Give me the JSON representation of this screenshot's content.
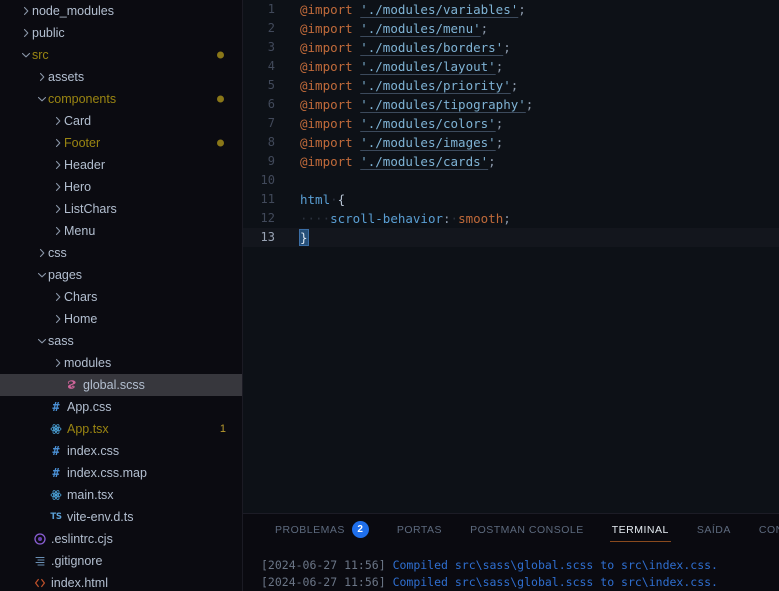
{
  "explorer": {
    "items": [
      {
        "label": "node_modules",
        "type": "folder",
        "state": "collapsed",
        "depth": 1,
        "color": "default",
        "icon": "chevron-right-icon"
      },
      {
        "label": "public",
        "type": "folder",
        "state": "collapsed",
        "depth": 1,
        "color": "default",
        "icon": "chevron-right-icon"
      },
      {
        "label": "src",
        "type": "folder",
        "state": "expanded",
        "depth": 1,
        "color": "modified",
        "icon": "chevron-down-icon",
        "dirty": true
      },
      {
        "label": "assets",
        "type": "folder",
        "state": "collapsed",
        "depth": 2,
        "color": "default",
        "icon": "chevron-right-icon"
      },
      {
        "label": "components",
        "type": "folder",
        "state": "expanded",
        "depth": 2,
        "color": "modified",
        "icon": "chevron-down-icon",
        "dirty": true
      },
      {
        "label": "Card",
        "type": "folder",
        "state": "collapsed",
        "depth": 3,
        "color": "default",
        "icon": "chevron-right-icon"
      },
      {
        "label": "Footer",
        "type": "folder",
        "state": "collapsed",
        "depth": 3,
        "color": "modified",
        "icon": "chevron-right-icon",
        "dirty": true
      },
      {
        "label": "Header",
        "type": "folder",
        "state": "collapsed",
        "depth": 3,
        "color": "default",
        "icon": "chevron-right-icon"
      },
      {
        "label": "Hero",
        "type": "folder",
        "state": "collapsed",
        "depth": 3,
        "color": "default",
        "icon": "chevron-right-icon"
      },
      {
        "label": "ListChars",
        "type": "folder",
        "state": "collapsed",
        "depth": 3,
        "color": "default",
        "icon": "chevron-right-icon"
      },
      {
        "label": "Menu",
        "type": "folder",
        "state": "collapsed",
        "depth": 3,
        "color": "default",
        "icon": "chevron-right-icon"
      },
      {
        "label": "css",
        "type": "folder",
        "state": "collapsed",
        "depth": 2,
        "color": "default",
        "icon": "chevron-right-icon"
      },
      {
        "label": "pages",
        "type": "folder",
        "state": "expanded",
        "depth": 2,
        "color": "default",
        "icon": "chevron-down-icon"
      },
      {
        "label": "Chars",
        "type": "folder",
        "state": "collapsed",
        "depth": 3,
        "color": "default",
        "icon": "chevron-right-icon"
      },
      {
        "label": "Home",
        "type": "folder",
        "state": "collapsed",
        "depth": 3,
        "color": "default",
        "icon": "chevron-right-icon"
      },
      {
        "label": "sass",
        "type": "folder",
        "state": "expanded",
        "depth": 2,
        "color": "default",
        "icon": "chevron-down-icon"
      },
      {
        "label": "modules",
        "type": "folder",
        "state": "collapsed",
        "depth": 3,
        "color": "default",
        "icon": "chevron-right-icon"
      },
      {
        "label": "global.scss",
        "type": "file",
        "depth": 3,
        "color": "default",
        "icon": "sass-icon",
        "selected": true
      },
      {
        "label": "App.css",
        "type": "file",
        "depth": 2,
        "color": "default",
        "icon": "css-icon"
      },
      {
        "label": "App.tsx",
        "type": "file",
        "depth": 2,
        "color": "modified",
        "icon": "react-icon",
        "badge": "1"
      },
      {
        "label": "index.css",
        "type": "file",
        "depth": 2,
        "color": "default",
        "icon": "css-icon"
      },
      {
        "label": "index.css.map",
        "type": "file",
        "depth": 2,
        "color": "default",
        "icon": "css-icon"
      },
      {
        "label": "main.tsx",
        "type": "file",
        "depth": 2,
        "color": "default",
        "icon": "react-icon"
      },
      {
        "label": "vite-env.d.ts",
        "type": "file",
        "depth": 2,
        "color": "default",
        "icon": "typescript-icon"
      },
      {
        "label": ".eslintrc.cjs",
        "type": "file",
        "depth": 1,
        "color": "default",
        "icon": "eslint-icon"
      },
      {
        "label": ".gitignore",
        "type": "file",
        "depth": 1,
        "color": "default",
        "icon": "gitignore-icon"
      },
      {
        "label": "index.html",
        "type": "file",
        "depth": 1,
        "color": "default",
        "icon": "html-icon"
      }
    ]
  },
  "editor": {
    "lines": [
      {
        "num": "1",
        "tokens": [
          {
            "t": "at",
            "v": "@import"
          },
          {
            "t": "sp",
            "v": " "
          },
          {
            "t": "str",
            "v": "'./modules/variables'"
          },
          {
            "t": "punct",
            "v": ";"
          }
        ]
      },
      {
        "num": "2",
        "tokens": [
          {
            "t": "at",
            "v": "@import"
          },
          {
            "t": "sp",
            "v": " "
          },
          {
            "t": "str",
            "v": "'./modules/menu'"
          },
          {
            "t": "punct",
            "v": ";"
          }
        ]
      },
      {
        "num": "3",
        "tokens": [
          {
            "t": "at",
            "v": "@import"
          },
          {
            "t": "sp",
            "v": " "
          },
          {
            "t": "str",
            "v": "'./modules/borders'"
          },
          {
            "t": "punct",
            "v": ";"
          }
        ]
      },
      {
        "num": "4",
        "tokens": [
          {
            "t": "at",
            "v": "@import"
          },
          {
            "t": "sp",
            "v": " "
          },
          {
            "t": "str",
            "v": "'./modules/layout'"
          },
          {
            "t": "punct",
            "v": ";"
          }
        ]
      },
      {
        "num": "5",
        "tokens": [
          {
            "t": "at",
            "v": "@import"
          },
          {
            "t": "sp",
            "v": " "
          },
          {
            "t": "str",
            "v": "'./modules/priority'"
          },
          {
            "t": "punct",
            "v": ";"
          }
        ]
      },
      {
        "num": "6",
        "tokens": [
          {
            "t": "at",
            "v": "@import"
          },
          {
            "t": "sp",
            "v": " "
          },
          {
            "t": "str",
            "v": "'./modules/tipography'"
          },
          {
            "t": "punct",
            "v": ";"
          }
        ]
      },
      {
        "num": "7",
        "tokens": [
          {
            "t": "at",
            "v": "@import"
          },
          {
            "t": "sp",
            "v": " "
          },
          {
            "t": "str",
            "v": "'./modules/colors'"
          },
          {
            "t": "punct",
            "v": ";"
          }
        ]
      },
      {
        "num": "8",
        "tokens": [
          {
            "t": "at",
            "v": "@import"
          },
          {
            "t": "sp",
            "v": " "
          },
          {
            "t": "str",
            "v": "'./modules/images'"
          },
          {
            "t": "punct",
            "v": ";"
          }
        ]
      },
      {
        "num": "9",
        "tokens": [
          {
            "t": "at",
            "v": "@import"
          },
          {
            "t": "sp",
            "v": " "
          },
          {
            "t": "str",
            "v": "'./modules/cards'"
          },
          {
            "t": "punct",
            "v": ";"
          }
        ]
      },
      {
        "num": "10",
        "tokens": []
      },
      {
        "num": "11",
        "tokens": [
          {
            "t": "tag",
            "v": "html"
          },
          {
            "t": "ws",
            "v": "·"
          },
          {
            "t": "brace",
            "v": "{"
          }
        ]
      },
      {
        "num": "12",
        "tokens": [
          {
            "t": "ws",
            "v": "····"
          },
          {
            "t": "prop",
            "v": "scroll-behavior"
          },
          {
            "t": "punct",
            "v": ":"
          },
          {
            "t": "ws",
            "v": "·"
          },
          {
            "t": "val",
            "v": "smooth"
          },
          {
            "t": "punct",
            "v": ";"
          }
        ]
      },
      {
        "num": "13",
        "tokens": [
          {
            "t": "selbrace",
            "v": "}"
          }
        ],
        "active": true
      }
    ]
  },
  "panel": {
    "tabs": [
      {
        "label": "PROBLEMAS",
        "active": false,
        "badge": "2"
      },
      {
        "label": "PORTAS",
        "active": false
      },
      {
        "label": "POSTMAN CONSOLE",
        "active": false
      },
      {
        "label": "TERMINAL",
        "active": true
      },
      {
        "label": "SAÍDA",
        "active": false
      },
      {
        "label": "CONSOLE DE DEP",
        "active": false
      }
    ],
    "terminal": {
      "lines": [
        {
          "timestamp": "[2024-06-27 11:56]",
          "message": "Compiled src\\sass\\global.scss to src\\index.css."
        },
        {
          "timestamp": "[2024-06-27 11:56]",
          "message": "Compiled src\\sass\\global.scss to src\\index.css."
        }
      ]
    }
  },
  "colors": {
    "editor_background": "#0d1117",
    "sidebar_background": "#0b0b11",
    "selection_background": "#37373d",
    "modified_accent": "#9a8512",
    "badge_blue": "#1f6feb",
    "active_tab_underline": "#8a4a1e",
    "string_token": "#7fb3d5",
    "keyword_token": "#c06a3a"
  }
}
